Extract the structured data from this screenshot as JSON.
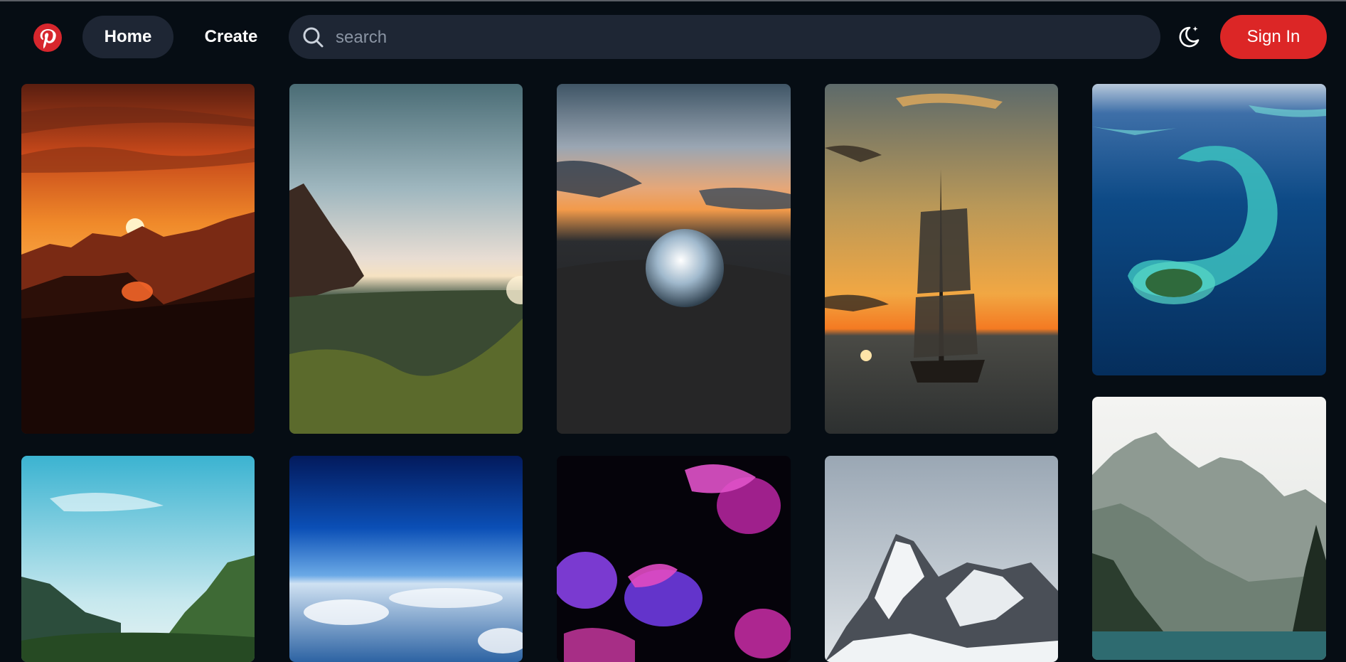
{
  "header": {
    "logo": {
      "icon": "pinterest-logo-icon",
      "color": "#d7262d"
    },
    "nav": {
      "home_label": "Home",
      "create_label": "Create"
    },
    "search": {
      "icon": "search-icon",
      "placeholder": "search",
      "value": ""
    },
    "theme_toggle": {
      "icon": "moon-star-icon"
    },
    "signin_label": "Sign In"
  },
  "pins": [
    {
      "icon": "sunset-mountains-image"
    },
    {
      "icon": "cliff-valley-image"
    },
    {
      "icon": "crystal-ball-sunset-image"
    },
    {
      "icon": "sailing-ship-sunset-image"
    },
    {
      "icon": "island-aerial-image"
    },
    {
      "icon": "sky-forest-image"
    },
    {
      "icon": "earth-clouds-image"
    },
    {
      "icon": "jellyfish-image"
    },
    {
      "icon": "snowy-peaks-image"
    },
    {
      "icon": "misty-mountain-lake-image"
    }
  ],
  "colors": {
    "background": "#060d14",
    "nav_pill": "#1e2634",
    "accent_red": "#dc2626"
  }
}
